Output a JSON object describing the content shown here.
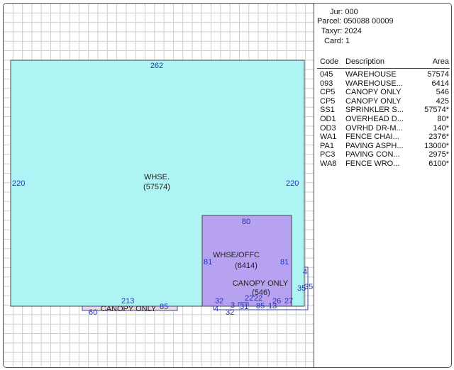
{
  "sketch": {
    "areas": [
      {
        "name": "WHSE.",
        "value": "(57574)"
      },
      {
        "name": "WHSE/OFFC",
        "value": "(6414)"
      },
      {
        "name": "CANOPY ONLY",
        "value": "(546)"
      },
      {
        "name": "CANOPY ONLY"
      }
    ],
    "dimensions": {
      "whse_top": "262",
      "whse_left": "220",
      "whse_right": "220",
      "whse_bottom": "213",
      "offc_top": "80",
      "offc_left": "81",
      "offc_right": "81",
      "bottom_small_85": "85",
      "bottom_small_60": "60",
      "step_4_right": "4",
      "step_35_right": "35",
      "step_3": "35",
      "canopy_32_a": "32",
      "canopy_32_b": "32",
      "canopy_3": "3",
      "canopy_4": "4",
      "canopy_22_a": "22",
      "canopy_22_b": "22",
      "canopy_26": "26",
      "canopy_27": "27",
      "canopy_85": "85",
      "canopy_13": "13",
      "canopy_31": "31"
    },
    "colors": {
      "whse": "#aef4f4",
      "offc": "#b7a2f2",
      "canopy_strip": "#f0d8d0",
      "grid": "#c8c8c8",
      "dim_text": "#2233bb"
    }
  },
  "panel": {
    "jur": "Jur: 000",
    "parcel": "Parcel: 050088  00009",
    "taxyr": "Taxyr: 2024",
    "card": "Card: 1",
    "columns": {
      "code": "Code",
      "description": "Description",
      "area": "Area"
    },
    "rows": [
      {
        "code": "045",
        "description": "WAREHOUSE",
        "area": "57574"
      },
      {
        "code": "093",
        "description": "WAREHOUSE...",
        "area": "6414"
      },
      {
        "code": "CP5",
        "description": "CANOPY ONLY",
        "area": "546"
      },
      {
        "code": "CP5",
        "description": "CANOPY ONLY",
        "area": "425"
      },
      {
        "code": "SS1",
        "description": "SPRINKLER S...",
        "area": "57574*"
      },
      {
        "code": "OD1",
        "description": "OVERHEAD D...",
        "area": "80*"
      },
      {
        "code": "OD3",
        "description": "OVRHD DR-M...",
        "area": "140*"
      },
      {
        "code": "WA1",
        "description": "FENCE CHAI...",
        "area": "2376*"
      },
      {
        "code": "PA1",
        "description": "PAVING ASPH...",
        "area": "13000*"
      },
      {
        "code": "PC3",
        "description": "PAVING CON...",
        "area": "2975*"
      },
      {
        "code": "WA8",
        "description": "FENCE WRO...",
        "area": "6100*"
      }
    ]
  }
}
